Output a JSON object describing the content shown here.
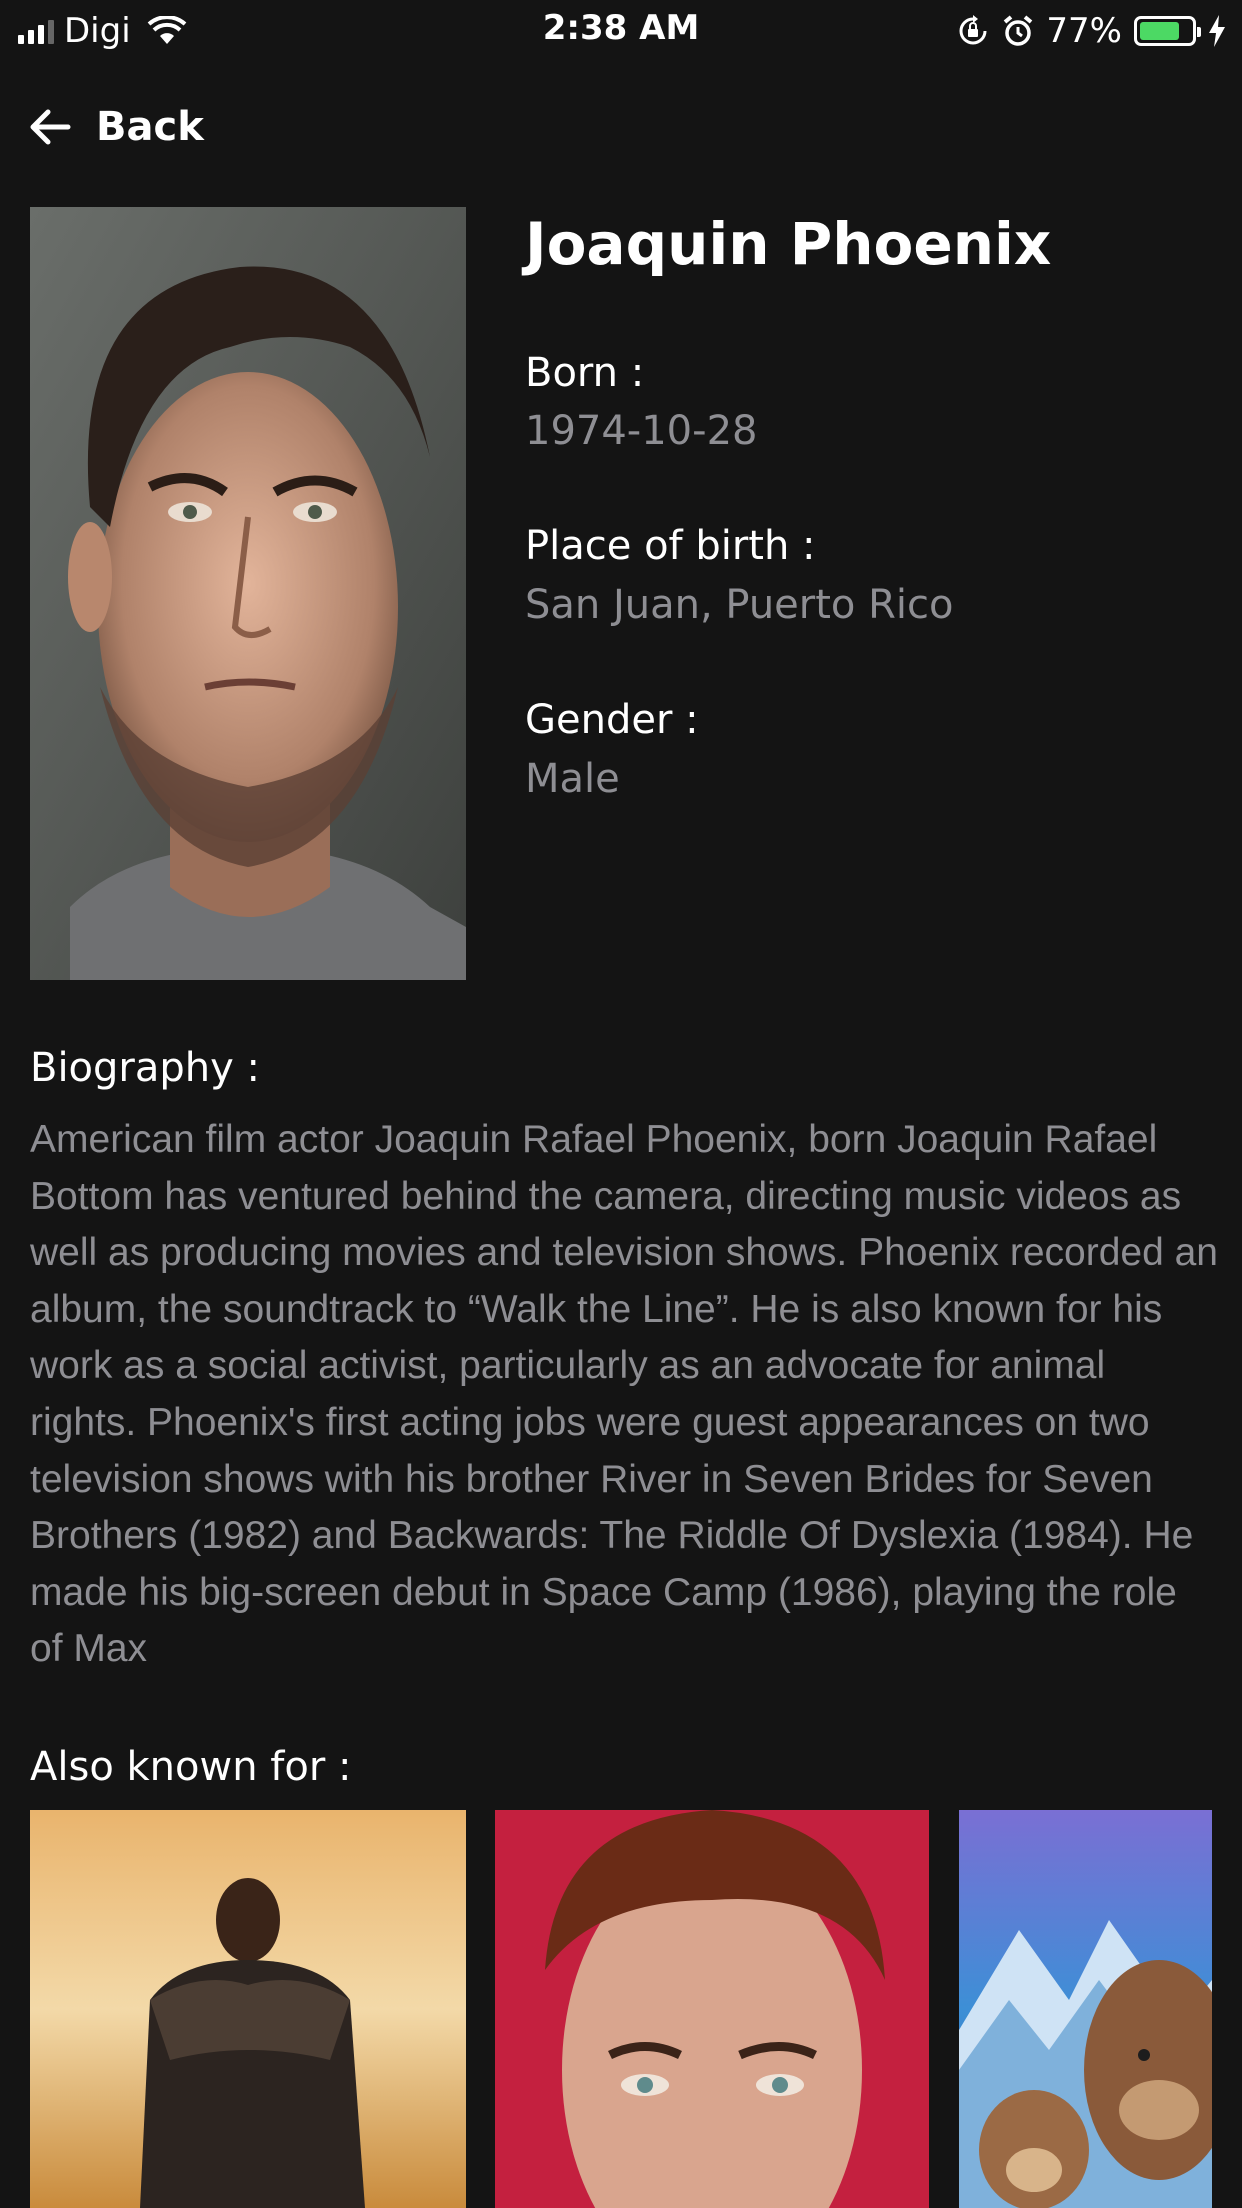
{
  "status_bar": {
    "carrier": "Digi",
    "time": "2:38 AM",
    "battery_percent": "77%",
    "battery_level": 0.77,
    "icons": [
      "signal-icon",
      "wifi-icon",
      "orientation-lock-icon",
      "alarm-icon",
      "battery-icon",
      "charging-bolt-icon"
    ]
  },
  "nav": {
    "back_label": "Back",
    "icon": "arrow-left-icon"
  },
  "person": {
    "name": "Joaquin Phoenix",
    "born_label": "Born :",
    "born_value": "1974-10-28",
    "place_label": "Place of birth :",
    "place_value": "San Juan, Puerto Rico",
    "gender_label": "Gender :",
    "gender_value": "Male"
  },
  "biography": {
    "title": "Biography :",
    "text": "American film actor Joaquin Rafael Phoenix, born Joaquin Rafael Bottom has ventured behind the camera, directing music videos as well as producing movies and television shows. Phoenix recorded an album, the soundtrack to “Walk the Line”. He is also known for his work as a social activist, particularly as an advocate for animal rights. Phoenix's first acting jobs were guest appearances on two television shows with his brother River in Seven Brides for Seven Brothers (1982) and Backwards: The Riddle Of Dyslexia (1984). He made his big-screen debut in Space Camp (1986), playing the role of Max"
  },
  "known_for": {
    "title": "Also known for :"
  },
  "colors": {
    "background": "#141414",
    "secondary_text": "#8e8e93",
    "battery": "#4cd964"
  }
}
